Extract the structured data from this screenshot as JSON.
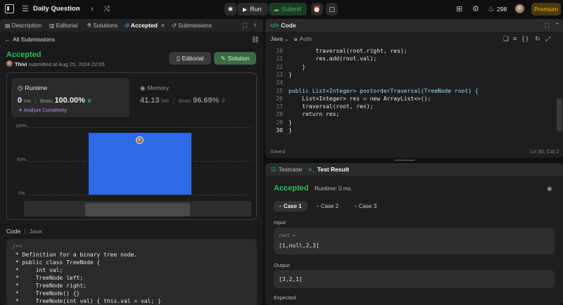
{
  "topbar": {
    "problem_list_label": "Daily Question",
    "run_label": "Run",
    "submit_label": "Submit",
    "streak_count": "298",
    "premium_label": "Premium"
  },
  "left_tabs": [
    {
      "label": "Description",
      "icon": "description-icon"
    },
    {
      "label": "Editorial",
      "icon": "editorial-icon"
    },
    {
      "label": "Solutions",
      "icon": "flask-icon"
    },
    {
      "label": "Accepted",
      "icon": "history-icon",
      "active": true
    },
    {
      "label": "Submissions",
      "icon": "history-icon"
    }
  ],
  "submission": {
    "back_label": "All Submissions",
    "status": "Accepted",
    "author": "Thivi",
    "submitted_text": "submitted at Aug 25, 2024 22:05",
    "editorial_label": "Editorial",
    "solution_label": "Solution"
  },
  "runtime": {
    "title": "Runtime",
    "value": "0",
    "unit": "ms",
    "beats_label": "Beats",
    "beats_value": "100.00%",
    "analyze_label": "Analyze Complexity"
  },
  "memory": {
    "title": "Memory",
    "value": "41.13",
    "unit": "MB",
    "beats_label": "Beats",
    "beats_value": "96.69%"
  },
  "chart_data": {
    "type": "bar",
    "categories": [
      "0ms"
    ],
    "values": [
      92
    ],
    "ylim": [
      0,
      100
    ],
    "yticks": [
      "100%",
      "50%",
      "0%"
    ],
    "bar_color": "#2d6ae3"
  },
  "submission_code": {
    "label": "Code",
    "language": "Java",
    "lines": [
      "/**",
      " * Definition for a binary tree node.",
      " * public class TreeNode {",
      " *     int val;",
      " *     TreeNode left;",
      " *     TreeNode right;",
      " *     TreeNode() {}",
      " *     TreeNode(int val) { this.val = val; }"
    ]
  },
  "editor": {
    "title": "Code",
    "language": "Java",
    "mode": "Auto",
    "status": "Saved",
    "cursor": "Ln 30, Col 2",
    "lines": [
      {
        "n": "20",
        "text": "        traversal(root.right, res);"
      },
      {
        "n": "21",
        "text": "        res.add(root.val);"
      },
      {
        "n": "22",
        "text": "    }"
      },
      {
        "n": "23",
        "text": "}"
      },
      {
        "n": "24",
        "text": ""
      },
      {
        "n": "25",
        "text": "public List<Integer> postorderTraversal(TreeNode root) {"
      },
      {
        "n": "26",
        "text": "    List<Integer> res = new ArrayList<>();"
      },
      {
        "n": "27",
        "text": "    traversal(root, res);"
      },
      {
        "n": "28",
        "text": "    return res;"
      },
      {
        "n": "29",
        "text": "}"
      },
      {
        "n": "30",
        "text": "}"
      }
    ]
  },
  "result": {
    "testcase_tab": "Testcase",
    "result_tab": "Test Result",
    "status": "Accepted",
    "runtime_text": "Runtime: 0 ms",
    "cases": [
      "Case 1",
      "Case 2",
      "Case 3"
    ],
    "input_label": "Input",
    "input_var": "root =",
    "input_value": "[1,null,2,3]",
    "output_label": "Output",
    "output_value": "[3,2,1]",
    "expected_label": "Expected"
  },
  "colors": {
    "accent_green": "#2cbb5d",
    "premium": "#ffb800",
    "bar_blue": "#2d6ae3"
  }
}
